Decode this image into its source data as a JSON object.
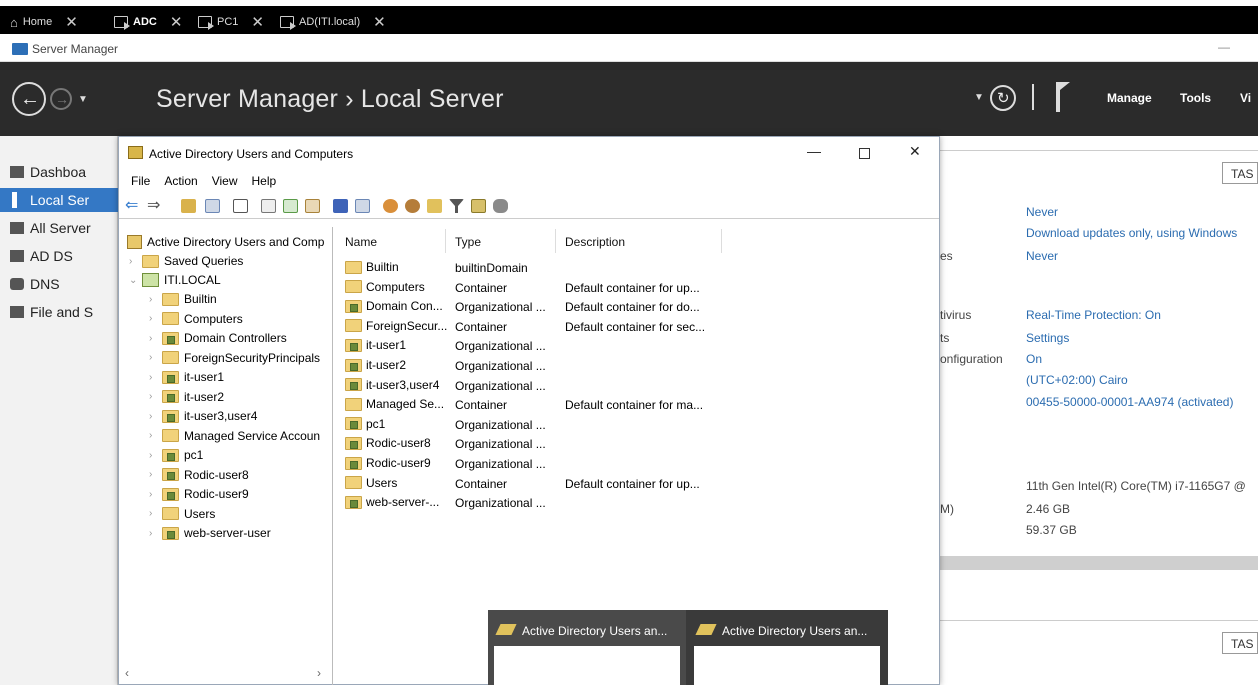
{
  "vm_tabs": [
    {
      "label": "Home",
      "active": false
    },
    {
      "label": "ADC",
      "active": true
    },
    {
      "label": "PC1",
      "active": false
    },
    {
      "label": "AD(ITI.local)",
      "active": false
    }
  ],
  "server_manager": {
    "title": "Server Manager",
    "breadcrumb": "Server Manager › Local Server",
    "menu": [
      "Manage",
      "Tools",
      "Vi"
    ],
    "nav": [
      "Dashboa",
      "Local Ser",
      "All Server",
      "AD DS",
      "DNS",
      "File and S"
    ]
  },
  "right_panel": {
    "tasks": "TAS",
    "tasks2": "TAS",
    "labels": [
      "es",
      "tivirus",
      "ts",
      "onfiguration",
      "M)"
    ],
    "values": [
      "Never",
      "Download updates only, using Windows",
      "Never",
      "Real-Time Protection: On",
      "Settings",
      "On",
      "(UTC+02:00) Cairo",
      "00455-50000-00001-AA974 (activated)",
      "11th Gen Intel(R) Core(TM) i7-1165G7 @",
      "2.46 GB",
      "59.37 GB"
    ]
  },
  "ad_window": {
    "title": "Active Directory Users and Computers",
    "menu": [
      "File",
      "Action",
      "View",
      "Help"
    ],
    "tree": {
      "root": "Active Directory Users and Comp",
      "saved": "Saved Queries",
      "domain": "ITI.LOCAL",
      "children": [
        "Builtin",
        "Computers",
        "Domain Controllers",
        "ForeignSecurityPrincipals",
        "it-user1",
        "it-user2",
        "it-user3,user4",
        "Managed Service Accoun",
        "pc1",
        "Rodic-user8",
        "Rodic-user9",
        "Users",
        "web-server-user"
      ]
    },
    "columns": [
      "Name",
      "Type",
      "Description"
    ],
    "rows": [
      {
        "name": "Builtin",
        "type": "builtinDomain",
        "desc": "",
        "ou": false
      },
      {
        "name": "Computers",
        "type": "Container",
        "desc": "Default container for up...",
        "ou": false
      },
      {
        "name": "Domain Con...",
        "type": "Organizational ...",
        "desc": "Default container for do...",
        "ou": true
      },
      {
        "name": "ForeignSecur...",
        "type": "Container",
        "desc": "Default container for sec...",
        "ou": false
      },
      {
        "name": "it-user1",
        "type": "Organizational ...",
        "desc": "",
        "ou": true
      },
      {
        "name": "it-user2",
        "type": "Organizational ...",
        "desc": "",
        "ou": true
      },
      {
        "name": "it-user3,user4",
        "type": "Organizational ...",
        "desc": "",
        "ou": true
      },
      {
        "name": "Managed Se...",
        "type": "Container",
        "desc": "Default container for ma...",
        "ou": false
      },
      {
        "name": "pc1",
        "type": "Organizational ...",
        "desc": "",
        "ou": true
      },
      {
        "name": "Rodic-user8",
        "type": "Organizational ...",
        "desc": "",
        "ou": true
      },
      {
        "name": "Rodic-user9",
        "type": "Organizational ...",
        "desc": "",
        "ou": true
      },
      {
        "name": "Users",
        "type": "Container",
        "desc": "Default container for up...",
        "ou": false
      },
      {
        "name": "web-server-...",
        "type": "Organizational ...",
        "desc": "",
        "ou": true
      }
    ]
  },
  "previews": [
    "Active Directory Users an...",
    "Active Directory Users an..."
  ]
}
